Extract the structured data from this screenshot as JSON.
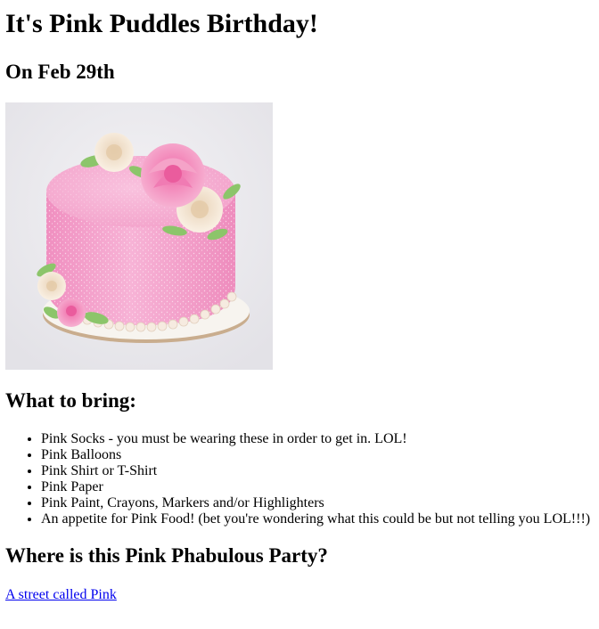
{
  "page": {
    "title": "It's Pink Puddles Birthday!",
    "date_heading": "On Feb 29th",
    "bring_heading": "What to bring:",
    "bring_items": [
      "Pink Socks - you must be wearing these in order to get in. LOL!",
      "Pink Balloons",
      "Pink Shirt or T-Shirt",
      "Pink Paper",
      "Pink Paint, Crayons, Markers and/or Highlighters",
      "An appetite for Pink Food! (bet you're wondering what this could be but not telling you LOL!!!)"
    ],
    "where_heading": "Where is this Pink Phabulous Party?",
    "location_link": "A street called Pink"
  },
  "colors": {
    "link": "#0000ee",
    "cake_frosting": "#f4a6cf",
    "image_background": "#ecebef"
  },
  "image": {
    "subject": "pink-birthday-cake"
  }
}
